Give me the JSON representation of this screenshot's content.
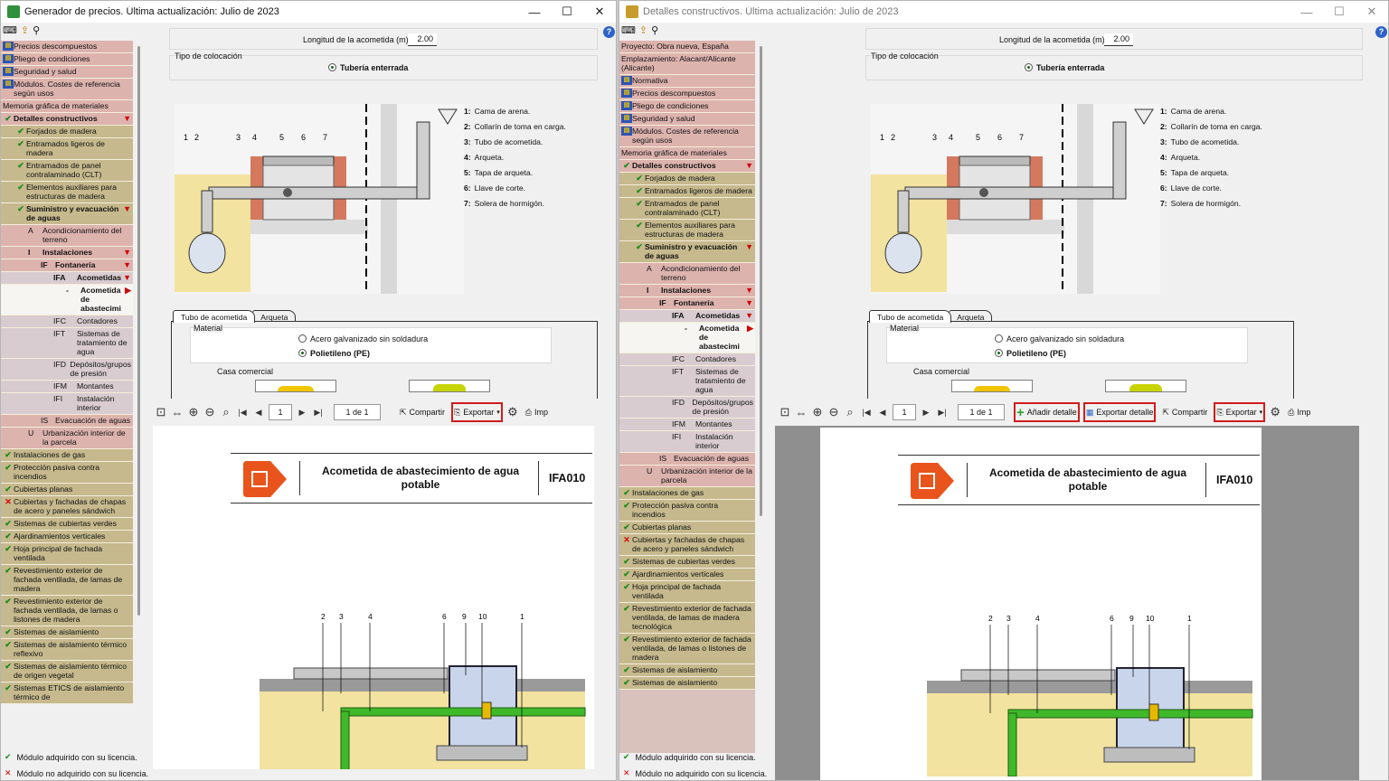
{
  "left": {
    "title": "Generador de precios. Última actualización: Julio de 2023",
    "win_controls": {
      "min": "—",
      "max": "☐",
      "close": "✕"
    },
    "tree": [
      {
        "label": "Precios descompuestos",
        "kind": "icon",
        "bg": "rose"
      },
      {
        "label": "Pliego de condiciones",
        "kind": "icon",
        "bg": "rose"
      },
      {
        "label": "Seguridad y salud",
        "kind": "icon",
        "bg": "rose"
      },
      {
        "label": "Módulos. Costes de referencia según usos",
        "kind": "icon",
        "bg": "rose"
      },
      {
        "label": "Memoria gráfica de materiales",
        "kind": "none",
        "bg": "rose"
      },
      {
        "label": "Detalles constructivos",
        "kind": "check",
        "bg": "rose",
        "bold": true,
        "arrow": "down"
      },
      {
        "label": "Forjados de madera",
        "kind": "check",
        "bg": "tan",
        "indent": 1
      },
      {
        "label": "Entramados ligeros de madera",
        "kind": "check",
        "bg": "tan",
        "indent": 1
      },
      {
        "label": "Entramados de panel contralaminado (CLT)",
        "kind": "check",
        "bg": "tan",
        "indent": 1
      },
      {
        "label": "Elementos auxiliares para estructuras de madera",
        "kind": "check",
        "bg": "tan",
        "indent": 1
      },
      {
        "label": "Suministro y evacuación de aguas",
        "kind": "check",
        "bg": "tan",
        "indent": 1,
        "bold": true,
        "arrow": "down"
      },
      {
        "code": "A",
        "label": "Acondicionamiento del terreno",
        "bg": "rose",
        "indent": 2
      },
      {
        "code": "I",
        "label": "Instalaciones",
        "bg": "rose",
        "indent": 2,
        "bold": true,
        "arrow": "down"
      },
      {
        "code": "IF",
        "label": "Fontanería",
        "bg": "rose",
        "indent": 3,
        "bold": true,
        "arrow": "down"
      },
      {
        "code": "IFA",
        "label": "Acometidas",
        "bg": "sel",
        "indent": 4,
        "bold": true,
        "arrow": "down"
      },
      {
        "code": "-",
        "label": "Acometida de abastecimi",
        "bg": "white",
        "indent": 5,
        "bold": true,
        "arrow": "right"
      },
      {
        "code": "IFC",
        "label": "Contadores",
        "bg": "sel",
        "indent": 4
      },
      {
        "code": "IFT",
        "label": "Sistemas de tratamiento de agua",
        "bg": "sel",
        "indent": 4
      },
      {
        "code": "IFD",
        "label": "Depósitos/grupos de presión",
        "bg": "sel",
        "indent": 4
      },
      {
        "code": "IFM",
        "label": "Montantes",
        "bg": "sel",
        "indent": 4
      },
      {
        "code": "IFI",
        "label": "Instalación interior",
        "bg": "sel",
        "indent": 4
      },
      {
        "code": "IS",
        "label": "Evacuación de aguas",
        "bg": "rose",
        "indent": 3
      },
      {
        "code": "U",
        "label": "Urbanización interior de la parcela",
        "bg": "rose",
        "indent": 2
      },
      {
        "label": "Instalaciones de gas",
        "kind": "check",
        "bg": "tan",
        "indent": 0
      },
      {
        "label": "Protección pasiva contra incendios",
        "kind": "check",
        "bg": "tan",
        "indent": 0
      },
      {
        "label": "Cubiertas planas",
        "kind": "check",
        "bg": "tan",
        "indent": 0
      },
      {
        "label": "Cubiertas y fachadas de chapas de acero y paneles sándwich",
        "kind": "cross",
        "bg": "tan",
        "indent": 0
      },
      {
        "label": "Sistemas de cubiertas verdes",
        "kind": "check",
        "bg": "tan",
        "indent": 0
      },
      {
        "label": "Ajardinamientos verticales",
        "kind": "check",
        "bg": "tan",
        "indent": 0
      },
      {
        "label": "Hoja principal de fachada ventilada",
        "kind": "check",
        "bg": "tan",
        "indent": 0
      },
      {
        "label": "Revestimiento exterior de fachada ventilada, de lamas de madera",
        "kind": "check",
        "bg": "tan",
        "indent": 0
      },
      {
        "label": "Revestimiento exterior de fachada ventilada, de lamas o listones de madera",
        "kind": "check",
        "bg": "tan",
        "indent": 0
      },
      {
        "label": "Sistemas de aislamiento",
        "kind": "check",
        "bg": "tan",
        "indent": 0
      },
      {
        "label": "Sistemas de aislamiento térmico reflexivo",
        "kind": "check",
        "bg": "tan",
        "indent": 0
      },
      {
        "label": "Sistemas de aislamiento térmico de origen vegetal",
        "kind": "check",
        "bg": "tan",
        "indent": 0
      },
      {
        "label": "Sistemas ETICS de aislamiento térmico de",
        "kind": "check",
        "bg": "tan",
        "indent": 0
      }
    ]
  },
  "right": {
    "title": "Detalles constructivos. Última actualización: Julio de 2023",
    "win_controls": {
      "min": "—",
      "max": "☐",
      "close": "✕"
    },
    "tree": [
      {
        "label": "Proyecto: Obra nueva, España",
        "kind": "none",
        "bg": "rose"
      },
      {
        "label": "Emplazamiento: Alacant/Alicante (Alicante)",
        "kind": "none",
        "bg": "rose"
      },
      {
        "label": "Normativa",
        "kind": "icon",
        "bg": "rose"
      },
      {
        "label": "Precios descompuestos",
        "kind": "icon",
        "bg": "rose"
      },
      {
        "label": "Pliego de condiciones",
        "kind": "icon",
        "bg": "rose"
      },
      {
        "label": "Seguridad y salud",
        "kind": "icon",
        "bg": "rose"
      },
      {
        "label": "Módulos. Costes de referencia según usos",
        "kind": "icon",
        "bg": "rose"
      },
      {
        "label": "Memoria gráfica de materiales",
        "kind": "none",
        "bg": "rose"
      },
      {
        "label": "Detalles constructivos",
        "kind": "check",
        "bg": "rose",
        "bold": true,
        "arrow": "down"
      },
      {
        "label": "Forjados de madera",
        "kind": "check",
        "bg": "tan",
        "indent": 1
      },
      {
        "label": "Entramados ligeros de madera",
        "kind": "check",
        "bg": "tan",
        "indent": 1
      },
      {
        "label": "Entramados de panel contralaminado (CLT)",
        "kind": "check",
        "bg": "tan",
        "indent": 1
      },
      {
        "label": "Elementos auxiliares para estructuras de madera",
        "kind": "check",
        "bg": "tan",
        "indent": 1
      },
      {
        "label": "Suministro y evacuación de aguas",
        "kind": "check",
        "bg": "tan",
        "indent": 1,
        "bold": true,
        "arrow": "down"
      },
      {
        "code": "A",
        "label": "Acondicionamiento del terreno",
        "bg": "rose",
        "indent": 2
      },
      {
        "code": "I",
        "label": "Instalaciones",
        "bg": "rose",
        "indent": 2,
        "bold": true,
        "arrow": "down"
      },
      {
        "code": "IF",
        "label": "Fontanería",
        "bg": "rose",
        "indent": 3,
        "bold": true,
        "arrow": "down"
      },
      {
        "code": "IFA",
        "label": "Acometidas",
        "bg": "sel",
        "indent": 4,
        "bold": true,
        "arrow": "down"
      },
      {
        "code": "-",
        "label": "Acometida de abastecimi",
        "bg": "white",
        "indent": 5,
        "bold": true,
        "arrow": "right"
      },
      {
        "code": "IFC",
        "label": "Contadores",
        "bg": "sel",
        "indent": 4
      },
      {
        "code": "IFT",
        "label": "Sistemas de tratamiento de agua",
        "bg": "sel",
        "indent": 4
      },
      {
        "code": "IFD",
        "label": "Depósitos/grupos de presión",
        "bg": "sel",
        "indent": 4
      },
      {
        "code": "IFM",
        "label": "Montantes",
        "bg": "sel",
        "indent": 4
      },
      {
        "code": "IFI",
        "label": "Instalación interior",
        "bg": "sel",
        "indent": 4
      },
      {
        "code": "IS",
        "label": "Evacuación de aguas",
        "bg": "rose",
        "indent": 3
      },
      {
        "code": "U",
        "label": "Urbanización interior de la parcela",
        "bg": "rose",
        "indent": 2
      },
      {
        "label": "Instalaciones de gas",
        "kind": "check",
        "bg": "tan",
        "indent": 0
      },
      {
        "label": "Protección pasiva contra incendios",
        "kind": "check",
        "bg": "tan",
        "indent": 0
      },
      {
        "label": "Cubiertas planas",
        "kind": "check",
        "bg": "tan",
        "indent": 0
      },
      {
        "label": "Cubiertas y fachadas de chapas de acero y paneles sándwich",
        "kind": "cross",
        "bg": "tan",
        "indent": 0
      },
      {
        "label": "Sistemas de cubiertas verdes",
        "kind": "check",
        "bg": "tan",
        "indent": 0
      },
      {
        "label": "Ajardinamientos verticales",
        "kind": "check",
        "bg": "tan",
        "indent": 0
      },
      {
        "label": "Hoja principal de fachada ventilada",
        "kind": "check",
        "bg": "tan",
        "indent": 0
      },
      {
        "label": "Revestimiento exterior de fachada ventilada, de lamas de madera tecnológica",
        "kind": "check",
        "bg": "tan",
        "indent": 0
      },
      {
        "label": "Revestimiento exterior de fachada ventilada, de lamas o listones de madera",
        "kind": "check",
        "bg": "tan",
        "indent": 0
      },
      {
        "label": "Sistemas de aislamiento",
        "kind": "check",
        "bg": "tan",
        "indent": 0
      },
      {
        "label": "Sistemas de aislamiento",
        "kind": "check",
        "bg": "tan",
        "indent": 0
      }
    ]
  },
  "shared": {
    "legend_ok": "Módulo adquirido con su licencia.",
    "legend_no": "Módulo no adquirido con su licencia.",
    "field_length_label": "Longitud de la acometida (m)",
    "field_length_value": "2.00",
    "placement_label": "Tipo de colocación",
    "placement_option": "Tubería enterrada",
    "drawing_legend": [
      {
        "n": "1:",
        "t": "Cama de arena."
      },
      {
        "n": "2:",
        "t": "Collarín de toma en carga."
      },
      {
        "n": "3:",
        "t": "Tubo de acometida."
      },
      {
        "n": "4:",
        "t": "Arqueta."
      },
      {
        "n": "5:",
        "t": "Tapa de arqueta."
      },
      {
        "n": "6:",
        "t": "Llave de corte."
      },
      {
        "n": "7:",
        "t": "Solera de hormigón."
      }
    ],
    "drawing_numbers": [
      "1",
      "2",
      "3",
      "4",
      "5",
      "6",
      "7"
    ],
    "tab_1": "Tubo de acometida",
    "tab_2": "Arqueta",
    "material_label": "Material",
    "material_opt1": "Acero galvanizado sin soldadura",
    "material_opt2": "Polietileno (PE)",
    "brand_label": "Casa comercial",
    "page_current": "1",
    "page_of": "1 de 1",
    "btn_share": "Compartir",
    "btn_export": "Exportar",
    "btn_print": "Imp",
    "btn_add_detail": "Añadir detalle",
    "btn_export_detail": "Exportar detalle",
    "doc_title": "Acometida de abastecimiento de agua potable",
    "doc_code": "IFA010",
    "doc_numbers": [
      "2",
      "3",
      "4",
      "6",
      "9",
      "10",
      "1"
    ]
  },
  "colors": {
    "rose": "#ddb3ae",
    "tan": "#c6b98d",
    "highlight": "#d11c1c",
    "pipe_green": "#3fb92a",
    "logo_orange": "#e8541c"
  }
}
